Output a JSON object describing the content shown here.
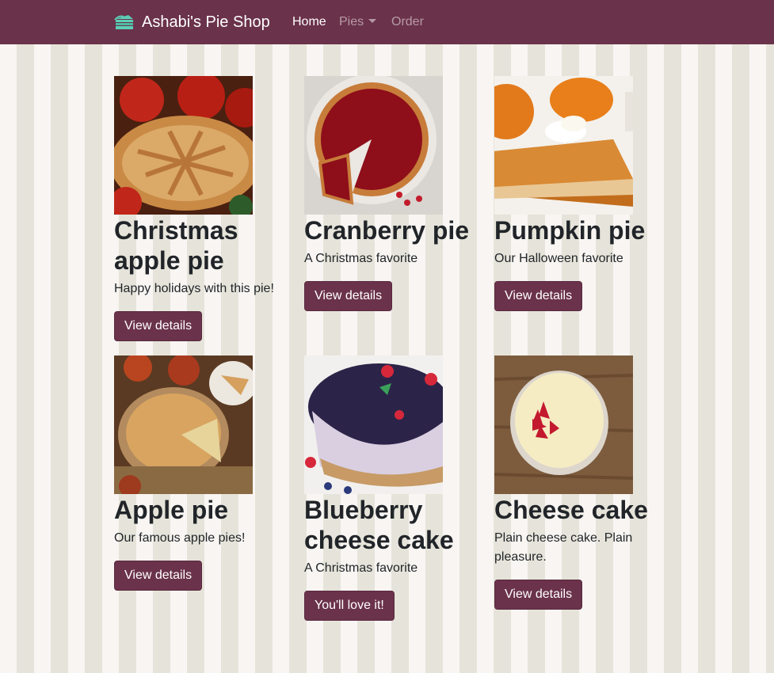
{
  "brand": {
    "name": "Ashabi's Pie Shop",
    "icon": "cake-slice-icon"
  },
  "nav": {
    "home": "Home",
    "pies": "Pies",
    "order": "Order"
  },
  "colors": {
    "primary": "#6b324b",
    "stripe_light": "#f8f5f2",
    "stripe_dark": "#e6e4da",
    "brand_icon": "#5ccfb6"
  },
  "pies": [
    {
      "name": "Christmas apple pie",
      "description": "Happy holidays with this pie!",
      "button": "View details"
    },
    {
      "name": "Cranberry pie",
      "description": "A Christmas favorite",
      "button": "View details"
    },
    {
      "name": "Pumpkin pie",
      "description": "Our Halloween favorite",
      "button": "View details"
    },
    {
      "name": "Apple pie",
      "description": "Our famous apple pies!",
      "button": "View details"
    },
    {
      "name": "Blueberry cheese cake",
      "description": "A Christmas favorite",
      "button": "You'll love it!"
    },
    {
      "name": "Cheese cake",
      "description": "Plain cheese cake. Plain pleasure.",
      "button": "View details"
    }
  ]
}
